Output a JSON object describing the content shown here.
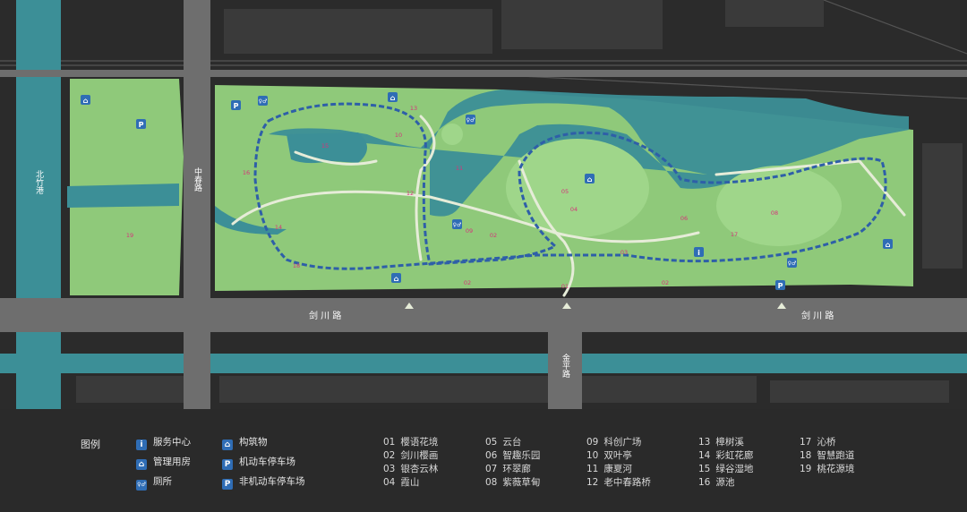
{
  "roads": {
    "beizhugang": "北竹港",
    "zhongchunlu": "中春路",
    "jianchuanlu_left": "剑 川 路",
    "jianchuanlu_right": "剑 川 路",
    "jinpinglu": "金平路"
  },
  "map_labels": [
    {
      "id": "m01",
      "text": "01"
    },
    {
      "id": "m02a",
      "text": "02"
    },
    {
      "id": "m02b",
      "text": "02"
    },
    {
      "id": "m03",
      "text": "03"
    },
    {
      "id": "m04",
      "text": "04"
    },
    {
      "id": "m05",
      "text": "05"
    },
    {
      "id": "m06",
      "text": "06"
    },
    {
      "id": "m07",
      "text": "07"
    },
    {
      "id": "m08",
      "text": "08"
    },
    {
      "id": "m09",
      "text": "09"
    },
    {
      "id": "m10",
      "text": "10"
    },
    {
      "id": "m11",
      "text": "11"
    },
    {
      "id": "m12",
      "text": "12"
    },
    {
      "id": "m13",
      "text": "13"
    },
    {
      "id": "m14",
      "text": "14"
    },
    {
      "id": "m15",
      "text": "15"
    },
    {
      "id": "m16",
      "text": "16"
    },
    {
      "id": "m17",
      "text": "17"
    },
    {
      "id": "m18",
      "text": "18"
    },
    {
      "id": "m19",
      "text": "19"
    }
  ],
  "legend": {
    "title": "图例",
    "icons": [
      {
        "icon": "service-center-icon",
        "glyph": "i",
        "label": "服务中心"
      },
      {
        "icon": "management-house-icon",
        "glyph": "⌂",
        "label": "管理用房"
      },
      {
        "icon": "toilet-icon",
        "glyph": "♀♂",
        "label": "厕所"
      },
      {
        "icon": "structure-icon",
        "glyph": "⌂",
        "label": "构筑物"
      },
      {
        "icon": "car-parking-icon",
        "glyph": "P",
        "label": "机动车停车场"
      },
      {
        "icon": "bike-parking-icon",
        "glyph": "P",
        "label": "非机动车停车场"
      }
    ],
    "places": [
      {
        "num": "01",
        "name": "樱语花境"
      },
      {
        "num": "02",
        "name": "剑川樱画"
      },
      {
        "num": "03",
        "name": "银杏云林"
      },
      {
        "num": "04",
        "name": "霞山"
      },
      {
        "num": "05",
        "name": "云台"
      },
      {
        "num": "06",
        "name": "智趣乐园"
      },
      {
        "num": "07",
        "name": "环翠廊"
      },
      {
        "num": "08",
        "name": "紫薇草甸"
      },
      {
        "num": "09",
        "name": "科创广场"
      },
      {
        "num": "10",
        "name": "双叶亭"
      },
      {
        "num": "11",
        "name": "康夏河"
      },
      {
        "num": "12",
        "name": "老中春路桥"
      },
      {
        "num": "13",
        "name": "樟树溪"
      },
      {
        "num": "14",
        "name": "彩虹花廊"
      },
      {
        "num": "15",
        "name": "绿谷湿地"
      },
      {
        "num": "16",
        "name": "源池"
      },
      {
        "num": "17",
        "name": "沁桥"
      },
      {
        "num": "18",
        "name": "智慧跑道"
      },
      {
        "num": "19",
        "name": "桃花源境"
      }
    ]
  },
  "colors": {
    "background": "#2b2b2b",
    "road": "#6e6e6e",
    "grass": "#8fc97a",
    "water": "#3c8f97",
    "path": "#e6ecd8",
    "route": "#2e5fa8",
    "icon_blue": "#2f6db5",
    "label_pink": "#d6337a"
  }
}
